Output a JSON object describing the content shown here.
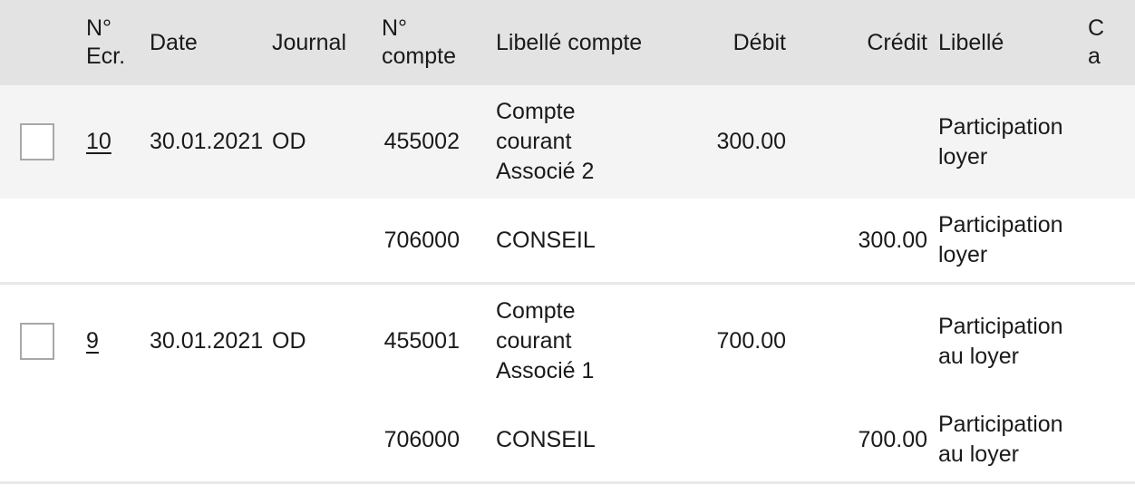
{
  "table": {
    "columns": [
      {
        "key": "select",
        "label": "",
        "icon": "checkbox-icon"
      },
      {
        "key": "entry_no",
        "label": "N° Ecr."
      },
      {
        "key": "date",
        "label": "Date"
      },
      {
        "key": "journal",
        "label": "Journal"
      },
      {
        "key": "account_no",
        "label": "N° compte"
      },
      {
        "key": "account_label",
        "label": "Libellé compte"
      },
      {
        "key": "debit",
        "label": "Débit"
      },
      {
        "key": "credit",
        "label": "Crédit"
      },
      {
        "key": "label",
        "label": "Libellé"
      },
      {
        "key": "clipped",
        "label": "C a"
      }
    ],
    "header": {
      "select": "",
      "entry_no_line1": "N°",
      "entry_no_line2": "Ecr.",
      "date": "Date",
      "journal": "Journal",
      "account_no_line1": "N°",
      "account_no_line2": "compte",
      "account_label": "Libellé compte",
      "debit": "Débit",
      "credit": "Crédit",
      "label": "Libellé",
      "clipped_line1": "C",
      "clipped_line2": "a"
    },
    "rows": [
      {
        "shaded": true,
        "group_end": false,
        "has_checkbox": true,
        "entry_no": "10",
        "date": "30.01.2021",
        "journal": "OD",
        "account_no": "455002",
        "account_label_lines": [
          "Compte",
          "courant",
          "Associé 2"
        ],
        "debit": "300.00",
        "credit": "",
        "label_lines": [
          "Participation",
          "loyer"
        ]
      },
      {
        "shaded": false,
        "group_end": true,
        "has_checkbox": false,
        "entry_no": "",
        "date": "",
        "journal": "",
        "account_no": "706000",
        "account_label_lines": [
          "CONSEIL"
        ],
        "debit": "",
        "credit": "300.00",
        "label_lines": [
          "Participation",
          "loyer"
        ]
      },
      {
        "shaded": false,
        "group_end": false,
        "has_checkbox": true,
        "entry_no": "9",
        "date": "30.01.2021",
        "journal": "OD",
        "account_no": "455001",
        "account_label_lines": [
          "Compte",
          "courant",
          "Associé 1"
        ],
        "debit": "700.00",
        "credit": "",
        "label_lines": [
          "Participation",
          "au loyer"
        ]
      },
      {
        "shaded": false,
        "group_end": true,
        "has_checkbox": false,
        "entry_no": "",
        "date": "",
        "journal": "",
        "account_no": "706000",
        "account_label_lines": [
          "CONSEIL"
        ],
        "debit": "",
        "credit": "700.00",
        "label_lines": [
          "Participation",
          "au loyer"
        ]
      }
    ]
  },
  "colors": {
    "header_background": "#e3e3e3",
    "row_shaded_background": "#f4f4f4",
    "row_background": "#ffffff",
    "divider": "#e8e8e8",
    "text": "#1a1a1a",
    "checkbox_border": "#a8a8a8"
  }
}
